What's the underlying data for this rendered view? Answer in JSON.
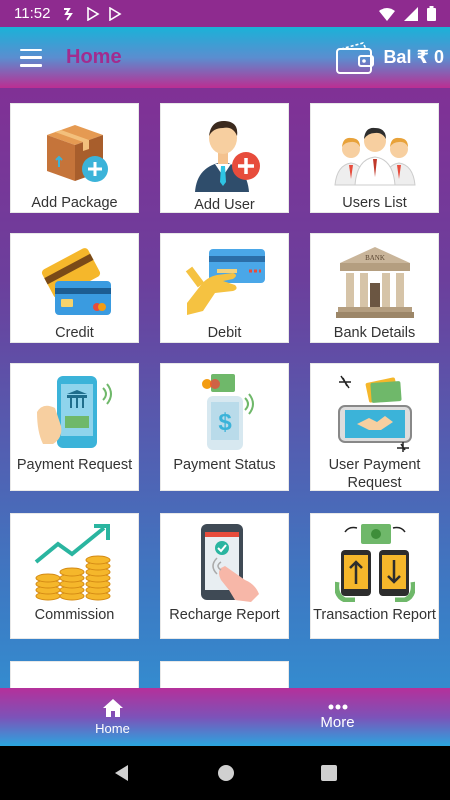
{
  "status_bar": {
    "time": "11:52",
    "notification_icons": [
      "alarm-icon",
      "play-store-icon",
      "play-store-icon"
    ],
    "system_icons": [
      "wifi-icon",
      "signal-icon",
      "battery-icon"
    ]
  },
  "app_bar": {
    "menu_icon": "hamburger-icon",
    "title": "Home",
    "balance_icon": "wallet-icon",
    "balance_label": "Bal ₹ 0"
  },
  "tiles": [
    {
      "label": "Add Package",
      "icon": "package-add-icon"
    },
    {
      "label": "Add User",
      "icon": "user-add-icon"
    },
    {
      "label": "Users List",
      "icon": "users-group-icon"
    },
    {
      "label": "Credit",
      "icon": "credit-cards-icon"
    },
    {
      "label": "Debit",
      "icon": "debit-card-hand-icon"
    },
    {
      "label": "Bank Details",
      "icon": "bank-icon"
    },
    {
      "label": "Payment Request",
      "icon": "phone-payment-icon"
    },
    {
      "label": "Payment Status",
      "icon": "phone-dollar-icon"
    },
    {
      "label": "User Payment Request",
      "icon": "handshake-phone-icon"
    },
    {
      "label": "Commission",
      "icon": "coins-growth-icon"
    },
    {
      "label": "Recharge Report",
      "icon": "phone-touch-icon"
    },
    {
      "label": "Transaction Report",
      "icon": "phones-transfer-icon"
    },
    {
      "label": "",
      "icon": "pencil-icon"
    },
    {
      "label": "",
      "icon": "hand-coin-icon"
    }
  ],
  "bottom_nav": {
    "home_label": "Home",
    "more_label": "More"
  },
  "colors": {
    "title": "#a22c8f",
    "status_bar": "#8e2b8f",
    "accent_blue": "#2aa0dc"
  }
}
